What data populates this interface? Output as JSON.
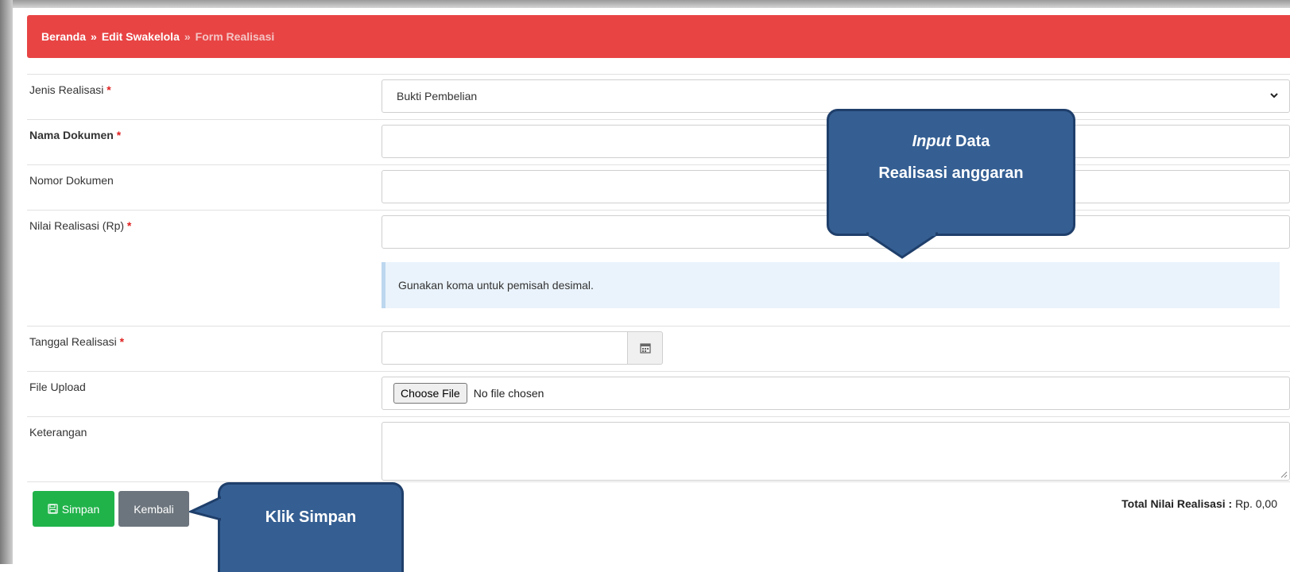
{
  "breadcrumb": {
    "home": "Beranda",
    "separator": "»",
    "edit": "Edit Swakelola",
    "current": "Form Realisasi"
  },
  "form": {
    "jenis_label": "Jenis Realisasi",
    "jenis_value": "Bukti Pembelian",
    "nama_label": "Nama Dokumen",
    "nomor_label": "Nomor Dokumen",
    "nilai_label": "Nilai Realisasi (Rp)",
    "help_text": "Gunakan koma untuk pemisah desimal.",
    "tanggal_label": "Tanggal Realisasi",
    "file_label": "File Upload",
    "choose_file": "Choose File",
    "no_file": "No file chosen",
    "keterangan_label": "Keterangan",
    "required_mark": "*"
  },
  "actions": {
    "save": "Simpan",
    "back": "Kembali"
  },
  "total": {
    "label": "Total Nilai Realisasi :",
    "value": "Rp. 0,00"
  },
  "callouts": {
    "input_italic": "Input",
    "input_rest": "Data",
    "input_line2": "Realisasi anggaran",
    "save": "Klik Simpan"
  },
  "colors": {
    "header": "#e84444",
    "save_button": "#20b34a",
    "back_button": "#6c757d",
    "callout": "#355f93"
  }
}
